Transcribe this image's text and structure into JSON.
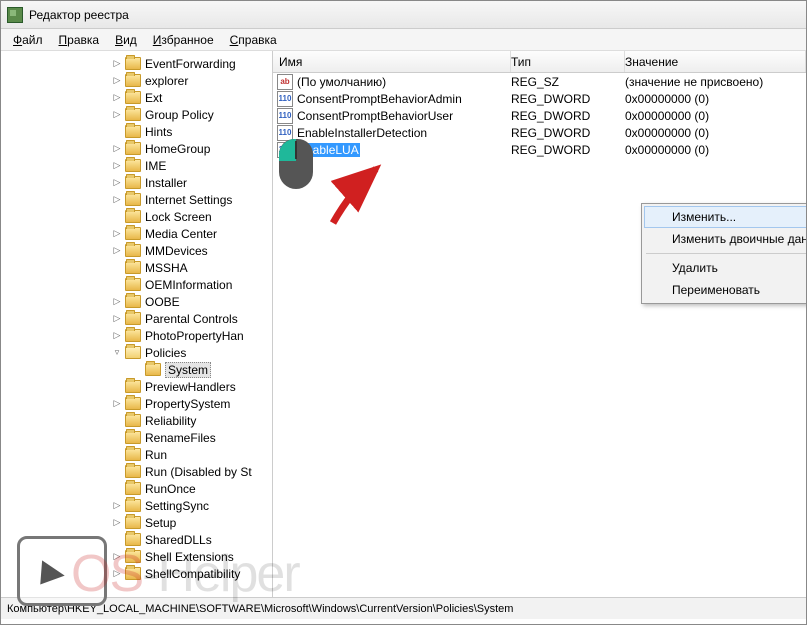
{
  "window": {
    "title": "Редактор реестра"
  },
  "menu": {
    "file": "Файл",
    "edit": "Правка",
    "view": "Вид",
    "favorites": "Избранное",
    "help": "Справка"
  },
  "tree": {
    "indent_base": 110,
    "nodes": [
      {
        "label": "EventForwarding",
        "exp": "▷"
      },
      {
        "label": "explorer",
        "exp": "▷"
      },
      {
        "label": "Ext",
        "exp": "▷"
      },
      {
        "label": "Group Policy",
        "exp": "▷"
      },
      {
        "label": "Hints",
        "exp": ""
      },
      {
        "label": "HomeGroup",
        "exp": "▷"
      },
      {
        "label": "IME",
        "exp": "▷"
      },
      {
        "label": "Installer",
        "exp": "▷"
      },
      {
        "label": "Internet Settings",
        "exp": "▷"
      },
      {
        "label": "Lock Screen",
        "exp": ""
      },
      {
        "label": "Media Center",
        "exp": "▷"
      },
      {
        "label": "MMDevices",
        "exp": "▷"
      },
      {
        "label": "MSSHA",
        "exp": ""
      },
      {
        "label": "OEMInformation",
        "exp": ""
      },
      {
        "label": "OOBE",
        "exp": "▷"
      },
      {
        "label": "Parental Controls",
        "exp": "▷"
      },
      {
        "label": "PhotoPropertyHan",
        "exp": "▷"
      },
      {
        "label": "Policies",
        "exp": "▿",
        "open": true
      },
      {
        "label": "System",
        "exp": "",
        "indent": 130,
        "selected": true
      },
      {
        "label": "PreviewHandlers",
        "exp": ""
      },
      {
        "label": "PropertySystem",
        "exp": "▷"
      },
      {
        "label": "Reliability",
        "exp": ""
      },
      {
        "label": "RenameFiles",
        "exp": ""
      },
      {
        "label": "Run",
        "exp": ""
      },
      {
        "label": "Run (Disabled by St",
        "exp": ""
      },
      {
        "label": "RunOnce",
        "exp": ""
      },
      {
        "label": "SettingSync",
        "exp": "▷"
      },
      {
        "label": "Setup",
        "exp": "▷"
      },
      {
        "label": "SharedDLLs",
        "exp": ""
      },
      {
        "label": "Shell Extensions",
        "exp": "▷"
      },
      {
        "label": "ShellCompatibility",
        "exp": "▷"
      }
    ]
  },
  "list": {
    "columns": {
      "name": "Имя",
      "type": "Тип",
      "value": "Значение"
    },
    "rows": [
      {
        "icon": "str",
        "name": "(По умолчанию)",
        "type": "REG_SZ",
        "value": "(значение не присвоено)"
      },
      {
        "icon": "dw",
        "name": "ConsentPromptBehaviorAdmin",
        "type": "REG_DWORD",
        "value": "0x00000000 (0)"
      },
      {
        "icon": "dw",
        "name": "ConsentPromptBehaviorUser",
        "type": "REG_DWORD",
        "value": "0x00000000 (0)"
      },
      {
        "icon": "dw",
        "name": "EnableInstallerDetection",
        "type": "REG_DWORD",
        "value": "0x00000000 (0)"
      },
      {
        "icon": "dw",
        "name": "EnableLUA",
        "type": "REG_DWORD",
        "value": "0x00000000 (0)",
        "selected": true
      }
    ]
  },
  "context": {
    "modify": "Изменить...",
    "modify_binary": "Изменить двоичные данные...",
    "delete": "Удалить",
    "rename": "Переименовать"
  },
  "status": "Компьютер\\HKEY_LOCAL_MACHINE\\SOFTWARE\\Microsoft\\Windows\\CurrentVersion\\Policies\\System",
  "watermark": {
    "part1": "OS",
    "part2": "-Helper"
  },
  "icon_glyph": {
    "str": "ab",
    "dw": "011\n110"
  }
}
